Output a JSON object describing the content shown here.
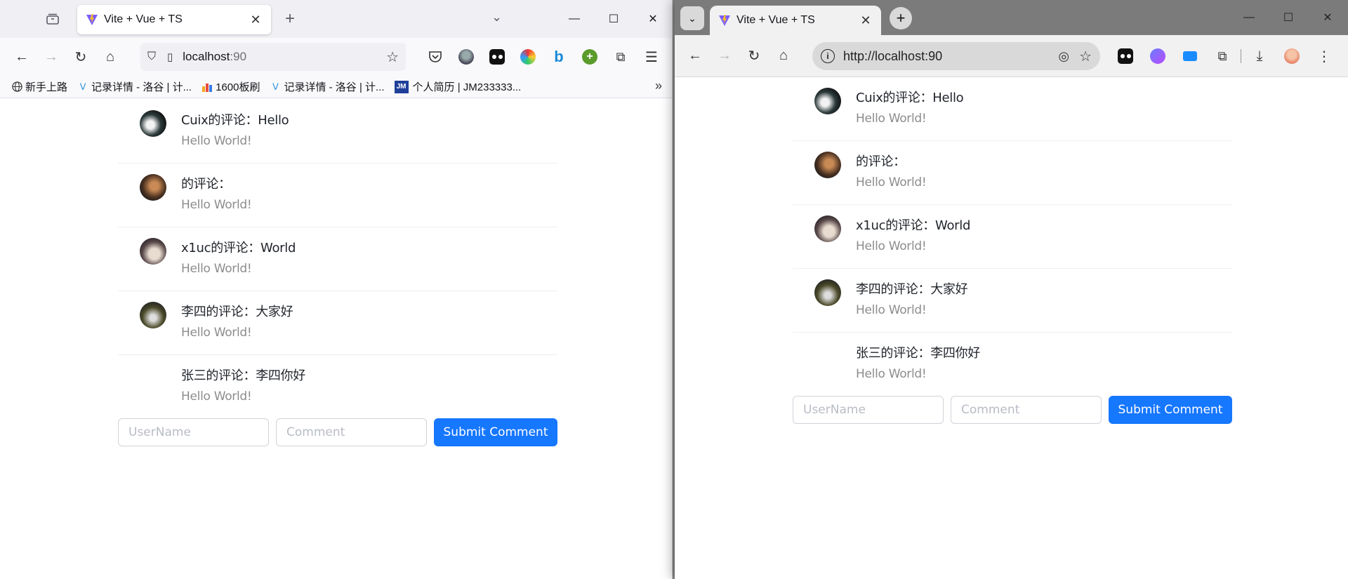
{
  "browser_left": {
    "tab_title": "Vite + Vue + TS",
    "url_host": "localhost",
    "url_port": ":90",
    "bookmarks": [
      {
        "label": "新手上路",
        "icon": "globe-icon"
      },
      {
        "label": "记录详情 - 洛谷 | 计...",
        "icon": "luogu-icon"
      },
      {
        "label": "1600板刷",
        "icon": "bar-chart-icon"
      },
      {
        "label": "记录详情 - 洛谷 | 计...",
        "icon": "luogu-icon"
      },
      {
        "label": "个人简历 | JM233333...",
        "icon": "jm-icon",
        "badge": "JM"
      }
    ]
  },
  "browser_right": {
    "tab_title": "Vite + Vue + TS",
    "url": "http://localhost:90"
  },
  "comments": [
    {
      "title": "Cuix的评论：Hello",
      "body": "Hello World!",
      "avatar": "avatar-cuix"
    },
    {
      "title": "的评论：",
      "body": "Hello World!",
      "avatar": "avatar-anon"
    },
    {
      "title": "x1uc的评论：World",
      "body": "Hello World!",
      "avatar": "avatar-x1uc"
    },
    {
      "title": "李四的评论：大家好",
      "body": "Hello World!",
      "avatar": "avatar-lisi"
    },
    {
      "title": "张三的评论：李四你好",
      "body": "Hello World!",
      "avatar": ""
    }
  ],
  "form": {
    "username_placeholder": "UserName",
    "comment_placeholder": "Comment",
    "submit_label": "Submit Comment"
  },
  "colors": {
    "primary": "#1677ff",
    "muted_text": "#8c8c8c",
    "title_text": "#1f2329"
  }
}
